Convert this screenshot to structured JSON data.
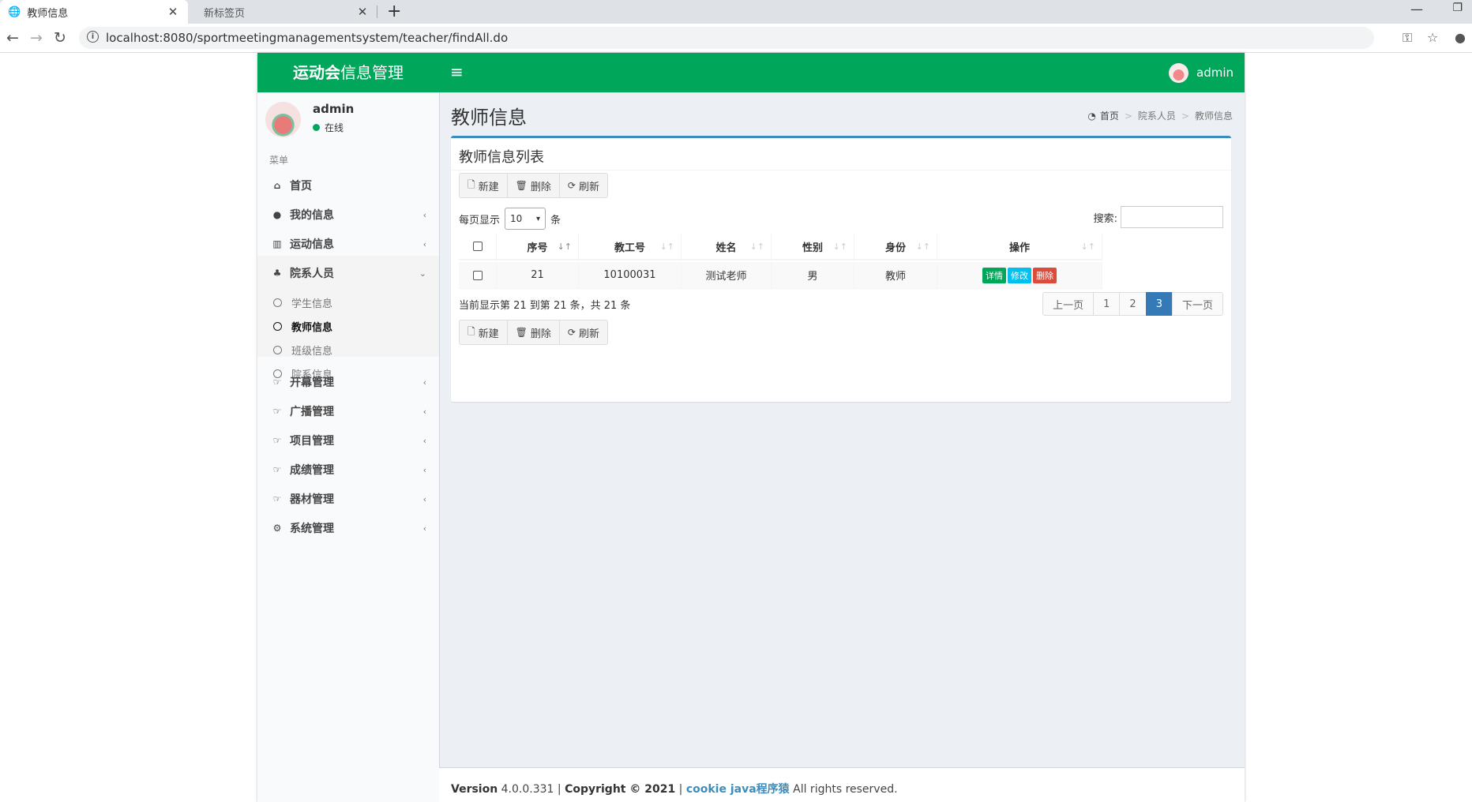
{
  "browser": {
    "tabs": [
      {
        "title": "教师信息"
      },
      {
        "title": "新标签页"
      }
    ],
    "url": "localhost:8080/sportmeetingmanagementsystem/teacher/findAll.do"
  },
  "header": {
    "logo_bold": "运动会",
    "logo_rest": "信息管理",
    "user": "admin"
  },
  "sidebar": {
    "user_name": "admin",
    "status": "在线",
    "menu_header": "菜单",
    "items": [
      {
        "label": "首页",
        "icon": "home-icon"
      },
      {
        "label": "我的信息",
        "icon": "user-icon"
      },
      {
        "label": "运动信息",
        "icon": "bar-chart-icon"
      },
      {
        "label": "院系人员",
        "icon": "users-icon"
      },
      {
        "label": "开幕管理",
        "icon": "hand-point-icon"
      },
      {
        "label": "广播管理",
        "icon": "hand-point-icon"
      },
      {
        "label": "项目管理",
        "icon": "hand-point-icon"
      },
      {
        "label": "成绩管理",
        "icon": "hand-point-icon"
      },
      {
        "label": "器材管理",
        "icon": "hand-point-icon"
      },
      {
        "label": "系统管理",
        "icon": "gear-icon"
      }
    ],
    "sub_items": [
      "学生信息",
      "教师信息",
      "班级信息",
      "院系信息"
    ]
  },
  "content": {
    "title": "教师信息",
    "breadcrumb": [
      "首页",
      "院系人员",
      "教师信息"
    ],
    "box_title": "教师信息列表",
    "buttons": {
      "new": "新建",
      "delete": "删除",
      "refresh": "刷新"
    },
    "length_prefix": "每页显示",
    "length_value": "10",
    "length_suffix": "条",
    "search_label": "搜索:",
    "table": {
      "columns": [
        "序号",
        "教工号",
        "姓名",
        "性别",
        "身份",
        "操作"
      ],
      "rows": [
        {
          "no": "21",
          "id": "10100031",
          "name": "测试老师",
          "gender": "男",
          "role": "教师"
        }
      ],
      "actions": {
        "detail": "详情",
        "edit": "修改",
        "delete": "删除"
      }
    },
    "info": "当前显示第 21 到第 21 条，共 21 条",
    "pagination": {
      "prev": "上一页",
      "pages": [
        "1",
        "2",
        "3"
      ],
      "next": "下一页"
    }
  },
  "footer": {
    "version_label": "Version",
    "version": "4.0.0.331",
    "copyright": "Copyright © 2021",
    "link": "cookie java程序猿",
    "rights": "All rights reserved."
  },
  "colors": {
    "header": "#00a65a",
    "box_top": "#3c8dbc",
    "detail_btn": "#00a65a",
    "edit_btn": "#00c0ef",
    "delete_btn": "#dd4b39",
    "page_active": "#337ab7"
  }
}
